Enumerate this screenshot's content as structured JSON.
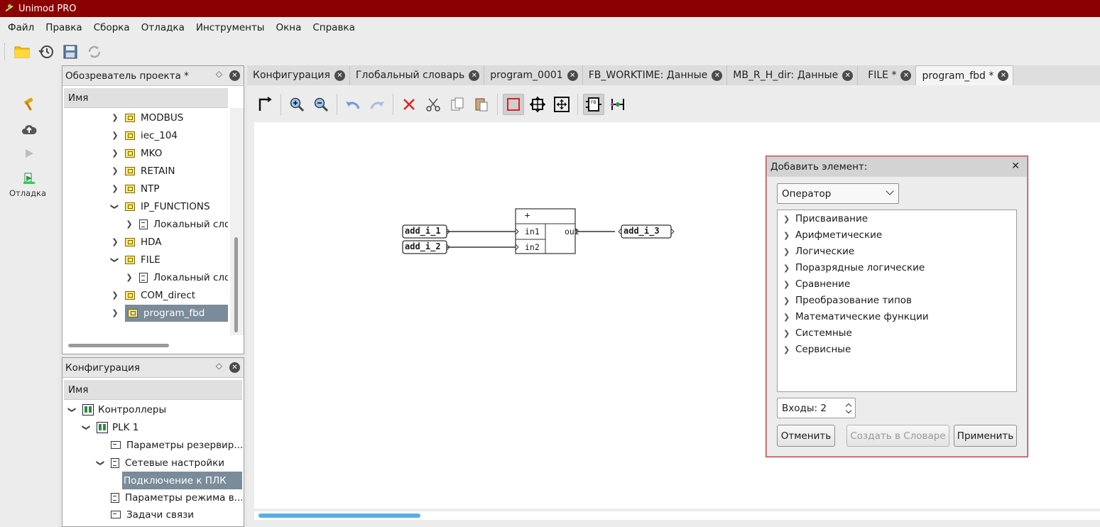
{
  "window": {
    "title": "Unimod PRO"
  },
  "menu": [
    "Файл",
    "Правка",
    "Сборка",
    "Отладка",
    "Инструменты",
    "Окна",
    "Справка"
  ],
  "left_rail": {
    "debug_label": "Отладка"
  },
  "project_explorer": {
    "title": "Обозреватель проекта *",
    "column": "Имя",
    "items": [
      {
        "label": "MODBUS",
        "type": "package",
        "expanded": false
      },
      {
        "label": "iec_104",
        "type": "package",
        "expanded": false
      },
      {
        "label": "MKO",
        "type": "package",
        "expanded": false
      },
      {
        "label": "RETAIN",
        "type": "package",
        "expanded": false
      },
      {
        "label": "NTP",
        "type": "package",
        "expanded": false
      },
      {
        "label": "IP_FUNCTIONS",
        "type": "package",
        "expanded": true
      },
      {
        "label": "Локальный слов",
        "type": "dict",
        "expanded": false
      },
      {
        "label": "HDA",
        "type": "package",
        "expanded": false
      },
      {
        "label": "FILE",
        "type": "package",
        "expanded": true
      },
      {
        "label": "Локальный слов",
        "type": "dict",
        "expanded": false
      },
      {
        "label": "COM_direct",
        "type": "package",
        "expanded": false
      },
      {
        "label": "program_fbd",
        "type": "package",
        "expanded": false,
        "selected": true
      }
    ]
  },
  "configuration": {
    "title": "Конфигурация",
    "column": "Имя",
    "items": [
      {
        "label": "Контроллеры"
      },
      {
        "label": "PLK 1"
      },
      {
        "label": "Параметры резервир..."
      },
      {
        "label": "Сетевые настройки"
      },
      {
        "label": "Подключение к ПЛК",
        "selected": true
      },
      {
        "label": "Параметры режима в..."
      },
      {
        "label": "Задачи связи"
      }
    ]
  },
  "tabs": [
    {
      "label": "Конфигурация"
    },
    {
      "label": "Глобальный словарь"
    },
    {
      "label": "program_0001"
    },
    {
      "label": "FB_WORKTIME: Данные"
    },
    {
      "label": "MB_R_H_dir: Данные"
    },
    {
      "label": "FILE *"
    },
    {
      "label": "program_fbd *",
      "active": true
    }
  ],
  "fbd": {
    "block_op": "+",
    "in1": "in1",
    "in2": "in2",
    "out": "out",
    "var_in1": "add_i_1",
    "var_in2": "add_i_2",
    "var_out": "add_i_3"
  },
  "dialog": {
    "title": "Добавить элемент:",
    "close": "✕",
    "type_selected": "Оператор",
    "categories": [
      "Присваивание",
      "Арифметические",
      "Логические",
      "Поразрядные логические",
      "Сравнение",
      "Преобразование типов",
      "Математические функции",
      "Системные",
      "Сервисные"
    ],
    "inputs_label": "Входы: 2",
    "cancel": "Отменить",
    "create_in_dict": "Создать в Словаре",
    "apply": "Применить"
  },
  "colors": {
    "titlebar": "#8b0000",
    "selection": "#7a8b99",
    "scroll_thumb": "#5aaee8"
  }
}
